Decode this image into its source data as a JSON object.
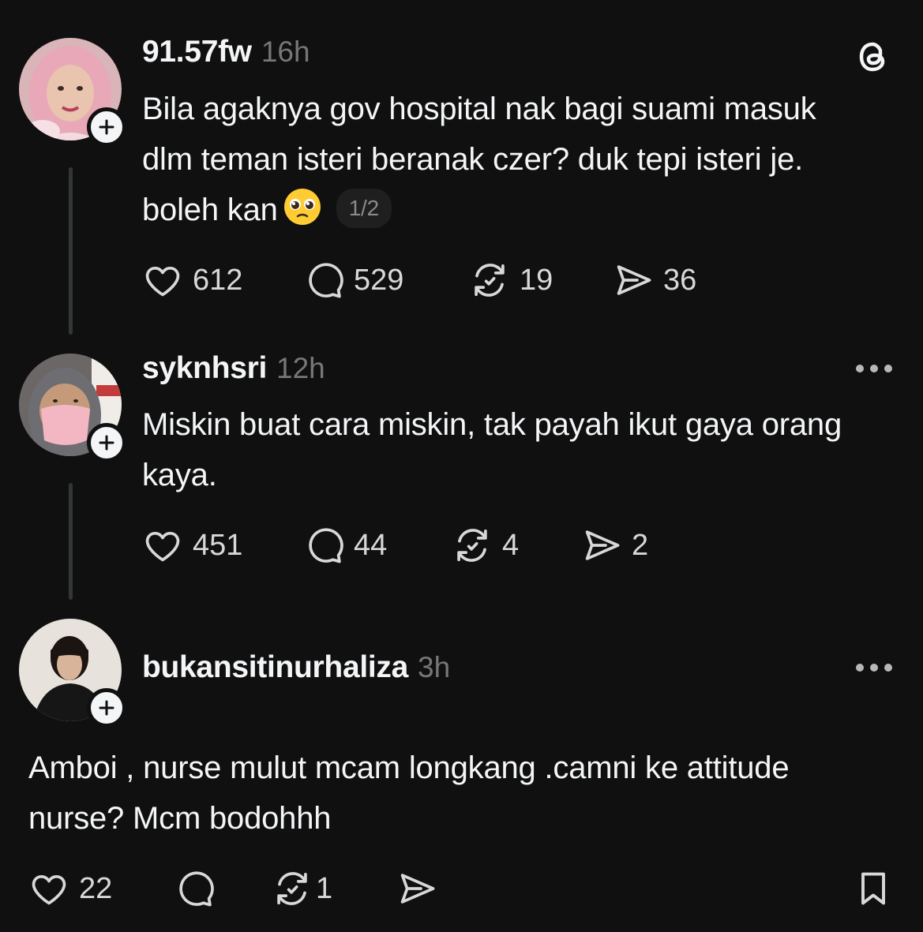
{
  "app": {
    "logo_icon": "threads-logo-icon"
  },
  "posts": [
    {
      "username": "91.57fw",
      "time": "16h",
      "text": "Bila agaknya gov hospital nak bagi suami masuk dlm teman isteri beranak czer? duk tepi isteri je. boleh kan",
      "emoji": "pleading-face-emoji",
      "page_indicator": "1/2",
      "likes": "612",
      "replies": "529",
      "reposts": "19",
      "shares": "36"
    },
    {
      "username": "syknhsri",
      "time": "12h",
      "text": "Miskin buat cara miskin, tak payah ikut gaya orang kaya.",
      "likes": "451",
      "replies": "44",
      "reposts": "4",
      "shares": "2"
    },
    {
      "username": "bukansitinurhaliza",
      "time": "3h",
      "text": "Amboi , nurse mulut mcam longkang .camni ke attitude nurse? Mcm bodohhh",
      "likes": "22",
      "reposts": "1"
    }
  ],
  "colors": {
    "background": "#101010",
    "text": "#f3f5f7",
    "muted": "#777777",
    "thread_line": "#333638"
  }
}
